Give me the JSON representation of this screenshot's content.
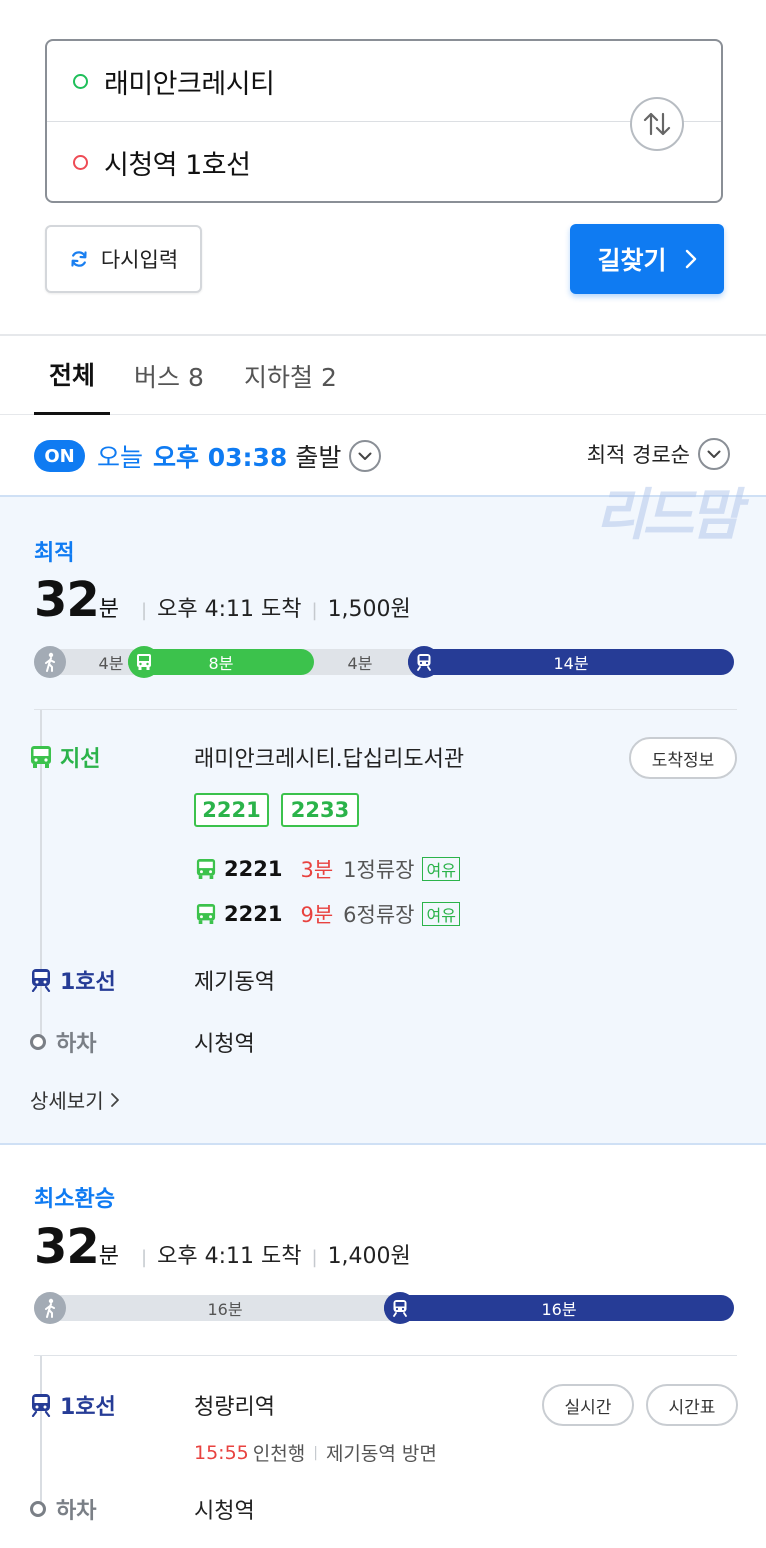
{
  "search": {
    "origin": "래미안크레시티",
    "destination": "시청역 1호선",
    "reset_label": "다시입력",
    "search_label": "길찾기"
  },
  "tabs": [
    {
      "label": "전체",
      "active": true
    },
    {
      "label": "버스 8",
      "active": false
    },
    {
      "label": "지하철 2",
      "active": false
    }
  ],
  "depart": {
    "toggle": "ON",
    "today": "오늘",
    "time": "오후 03:38",
    "suffix": "출발",
    "sort": "최적 경로순"
  },
  "routes": [
    {
      "label": "최적",
      "minutes": "32",
      "minutes_unit": "분",
      "arrive": "오후 4:11 도착",
      "fare": "1,500원",
      "segments": [
        {
          "type": "walk",
          "label": "4분"
        },
        {
          "type": "bus",
          "label": "8분"
        },
        {
          "type": "walk",
          "label": "4분"
        },
        {
          "type": "subway",
          "label": "14분"
        }
      ],
      "steps": {
        "bus_label": "지선",
        "bus_stop": "래미안크레시티.답십리도서관",
        "arrival_info_button": "도착정보",
        "bus_routes": [
          "2221",
          "2233"
        ],
        "arrivals": [
          {
            "route": "2221",
            "minutes": "3분",
            "stops": "1정류장",
            "congestion": "여유"
          },
          {
            "route": "2221",
            "minutes": "9분",
            "stops": "6정류장",
            "congestion": "여유"
          }
        ],
        "subway_label": "1호선",
        "subway_stop": "제기동역",
        "alight_label": "하차",
        "alight_stop": "시청역",
        "more": "상세보기"
      }
    },
    {
      "label": "최소환승",
      "minutes": "32",
      "minutes_unit": "분",
      "arrive": "오후 4:11 도착",
      "fare": "1,400원",
      "segments": [
        {
          "type": "walk",
          "label": "16분"
        },
        {
          "type": "subway",
          "label": "16분"
        }
      ],
      "steps": {
        "subway_label": "1호선",
        "subway_stop": "청량리역",
        "realtime_button": "실시간",
        "timetable_button": "시간표",
        "train_time": "15:55",
        "train_dest": "인천행",
        "train_dir": "제기동역 방면",
        "alight_label": "하차",
        "alight_stop": "시청역"
      }
    }
  ],
  "watermark": "리드맘",
  "colors": {
    "accent": "#0f7bf2",
    "bus_green": "#3cc24c",
    "subway_line1": "#263c96",
    "walk_gray": "#a3abb5",
    "alert_red": "#e8423f"
  }
}
